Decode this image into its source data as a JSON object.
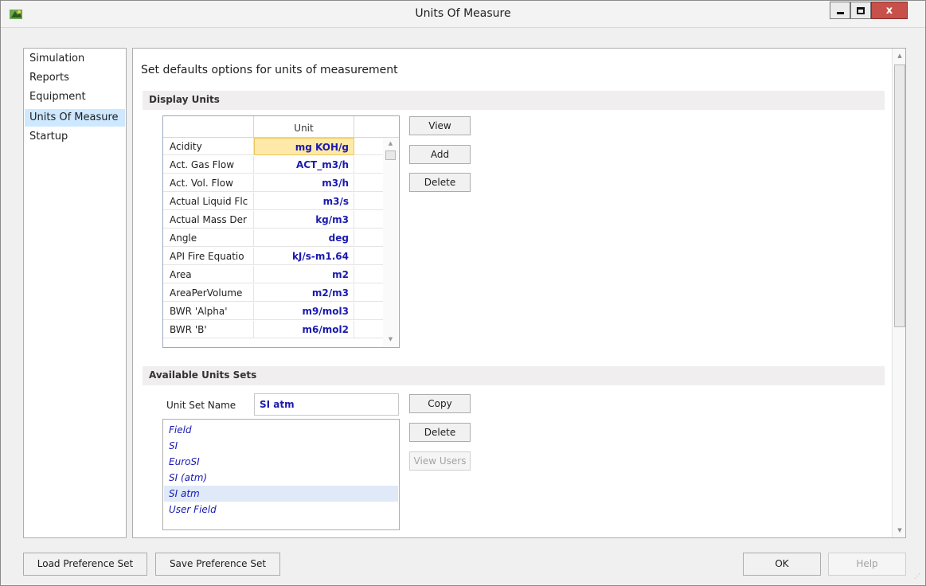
{
  "window": {
    "title": "Units Of Measure",
    "close_glyph": "x"
  },
  "nav": {
    "items": [
      {
        "label": "Simulation"
      },
      {
        "label": "Reports"
      },
      {
        "label": "Equipment"
      },
      {
        "label": "Units Of Measure",
        "selected": true
      },
      {
        "label": "Startup"
      }
    ]
  },
  "content": {
    "heading": "Set defaults options for units of measurement",
    "display_units": {
      "section_title": "Display Units",
      "column_header": "Unit",
      "rows": [
        {
          "name": "Acidity",
          "unit": "mg KOH/g",
          "active": true
        },
        {
          "name": "Act. Gas Flow",
          "unit": "ACT_m3/h"
        },
        {
          "name": "Act. Vol. Flow",
          "unit": "m3/h"
        },
        {
          "name": "Actual Liquid Flc",
          "unit": "m3/s"
        },
        {
          "name": "Actual Mass Der",
          "unit": "kg/m3"
        },
        {
          "name": "Angle",
          "unit": "deg"
        },
        {
          "name": "API Fire Equatio",
          "unit": "kJ/s-m1.64"
        },
        {
          "name": "Area",
          "unit": "m2"
        },
        {
          "name": "AreaPerVolume",
          "unit": "m2/m3"
        },
        {
          "name": "BWR  'Alpha'",
          "unit": "m9/mol3"
        },
        {
          "name": "BWR  'B'",
          "unit": "m6/mol2"
        }
      ],
      "buttons": {
        "view": "View",
        "add": "Add",
        "delete": "Delete"
      }
    },
    "available_sets": {
      "section_title": "Available Units Sets",
      "unit_set_name_label": "Unit Set Name",
      "unit_set_name_value": "SI atm",
      "sets": [
        {
          "label": "Field"
        },
        {
          "label": "SI"
        },
        {
          "label": "EuroSI"
        },
        {
          "label": "SI (atm)"
        },
        {
          "label": "SI atm",
          "selected": true
        },
        {
          "label": "User Field"
        }
      ],
      "buttons": {
        "copy": "Copy",
        "delete": "Delete",
        "view_users": "View Users"
      }
    }
  },
  "footer": {
    "load": "Load Preference Set",
    "save": "Save Preference Set",
    "ok": "OK",
    "help": "Help"
  },
  "colors": {
    "unit_text": "#1a1ab0",
    "active_cell": "#ffe9a8",
    "nav_selected": "#cde8ff",
    "close_button": "#c7504a"
  }
}
